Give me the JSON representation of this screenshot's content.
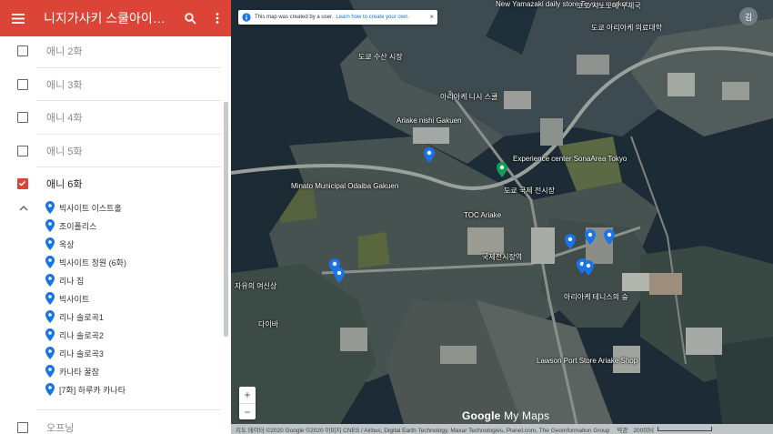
{
  "header": {
    "title": "니지가사키 스쿨아이돌 ..."
  },
  "layers": [
    {
      "label": "애니 2화",
      "checked": false
    },
    {
      "label": "애니 3화",
      "checked": false
    },
    {
      "label": "애니 4화",
      "checked": false
    },
    {
      "label": "애니 5화",
      "checked": false
    },
    {
      "label": "애니 6화",
      "checked": true
    },
    {
      "label": "오프닝",
      "checked": false
    }
  ],
  "places": [
    "빅사이트 이스트홀",
    "조이폴리스",
    "옥상",
    "빅사이트 정원 (6화)",
    "리나 집",
    "빅사이트",
    "리나 솔로곡1",
    "리나 솔로곡2",
    "리나 솔로곡3",
    "카나타 꿀잠",
    "[7화] 하루카 카나타"
  ],
  "map": {
    "notice_text": "This map was created by a user.",
    "notice_link": "Learn how to create your own.",
    "notice_close": "×",
    "avatar_initial": "김",
    "zoom_in": "+",
    "zoom_out": "−",
    "brand_google": "Google",
    "brand_mymaps": "My Maps",
    "attribution": "지도 데이터 ©2020 Google ©2020 이미지 CNES / Airbus, Digital Earth Technology, Maxar Technologies, Planet.com, The GeoInformation Group",
    "terms": "약관",
    "scale": "200미터",
    "labels": [
      "New Yamazaki daily store Toyosu market",
      "도쿄 수산 시장",
      "아리아케 니시 스쿨",
      "Ariake nishi Gakuen",
      "Experience center SonaArea Tokyo",
      "Minato Municipal Odaiba Gakuen",
      "TOC Ariake",
      "도쿄 국제 전시장",
      "자유의 여신상",
      "Lawson Port Store Ariake Shop",
      "코토 시노노메 우체국",
      "도쿄 아리아케 의료대학",
      "아리아케 테니스의 숲",
      "다이바",
      "국제전시장역"
    ]
  },
  "colors": {
    "accent": "#db4437",
    "pin": "#1a73e8",
    "green_pin": "#0f9d58"
  }
}
